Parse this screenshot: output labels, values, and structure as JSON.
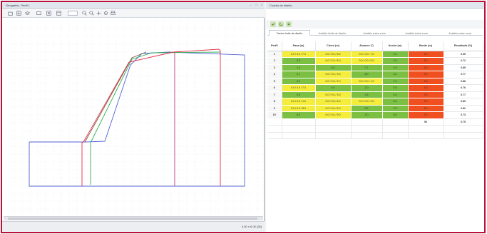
{
  "left_panel": {
    "title": "Geografía - Perfil 1",
    "status_coords": "0.00 x 0.00 (25)"
  },
  "right_panel": {
    "title": "Cuadro de diseño",
    "tabs": [
      "Factor límite de diseño",
      "Análisis límite de diseño",
      "Análisis sobre zona",
      "Análisis sobre zona",
      "Análisis sobre zona"
    ],
    "columns": [
      "Perfil",
      "Pasa (m)",
      "Cierre (m)",
      "Alcance (°)",
      "Ancho (m)",
      "Borde (m)",
      "Resultado (%)"
    ],
    "rows": [
      {
        "n": "1",
        "cells": [
          "0.0 / 0.0 / 7.0",
          "0.0 / 0.0 / 6.0",
          "0.0 / 0.0 / 7.0",
          "9.5",
          "3.0",
          "0.95"
        ],
        "colors": [
          "y",
          "y",
          "y",
          "g",
          "r",
          "w"
        ]
      },
      {
        "n": "2",
        "cells": [
          "5.0",
          "0.0 / 0.0 / 6.0",
          "0.0 / 0.0 / 5.0",
          "3.5",
          "3.0",
          "0.72"
        ],
        "colors": [
          "g",
          "y",
          "y",
          "g",
          "r",
          "w"
        ]
      },
      {
        "n": "3",
        "cells": [
          "1.4",
          "5.0",
          "0.7",
          "4.5",
          "3.0",
          "0.89"
        ],
        "colors": [
          "g",
          "g",
          "g",
          "g",
          "r",
          "w"
        ]
      },
      {
        "n": "4",
        "cells": [
          "3.7",
          "0.0 / 0.0 / 3.0",
          "6.0",
          "3.5",
          "3.0",
          "0.77"
        ],
        "colors": [
          "g",
          "y",
          "g",
          "g",
          "r",
          "w"
        ]
      },
      {
        "n": "5",
        "cells": [
          "8.0",
          "0.0 / 0.0 / 2.0",
          "0.0 / 0.0 / 1.0",
          "7.0",
          "3.0",
          "0.88"
        ],
        "colors": [
          "g",
          "y",
          "y",
          "g",
          "r",
          "w"
        ]
      },
      {
        "n": "6",
        "cells": [
          "0.0 / 0.0 / 7.0",
          "5.0",
          "2.0",
          "0.5",
          "3.0",
          "0.76"
        ],
        "colors": [
          "y",
          "g",
          "g",
          "g",
          "r",
          "w"
        ]
      },
      {
        "n": "7",
        "cells": [
          "9.0",
          "0.0 / 0.0 / 3.0",
          "3.5",
          "4.5",
          "3.0",
          "0.77"
        ],
        "colors": [
          "g",
          "y",
          "g",
          "g",
          "r",
          "w"
        ]
      },
      {
        "n": "8",
        "cells": [
          "0.0 / 0.0 / 1.0",
          "0.0 / 0.0 / 4.0",
          "0.0 / 0.0 / 3.0",
          "6.5",
          "3.0",
          "0.89"
        ],
        "colors": [
          "y",
          "y",
          "y",
          "g",
          "r",
          "w"
        ]
      },
      {
        "n": "9",
        "cells": [
          "0.0 / 0.0 / 8.0",
          "0.0 / 0.0 / 5.0",
          "5.5",
          "3.5",
          "3.0",
          "0.82"
        ],
        "colors": [
          "y",
          "y",
          "g",
          "g",
          "r",
          "w"
        ]
      },
      {
        "n": "10",
        "cells": [
          "8.0",
          "0.0 / 0.0 / 9.0",
          "3.0",
          "6.5",
          "3.0",
          "0.73"
        ],
        "colors": [
          "g",
          "y",
          "g",
          "g",
          "r",
          "w"
        ]
      }
    ],
    "total_row": {
      "borde": "50",
      "resultado": "0.75"
    }
  },
  "profile": {
    "lines": [
      {
        "color": "#5561d8",
        "points": [
          [
            36,
            196
          ],
          [
            115,
            196
          ],
          [
            142,
            195
          ],
          [
            178,
            88
          ],
          [
            194,
            72
          ],
          [
            232,
            70
          ],
          [
            338,
            74
          ],
          [
            338,
            258
          ],
          [
            36,
            258
          ],
          [
            36,
            196
          ]
        ]
      },
      {
        "color": "#7b5a3a",
        "points": [
          [
            114,
            196
          ],
          [
            180,
            78
          ],
          [
            200,
            70
          ]
        ]
      },
      {
        "color": "#2fae55",
        "points": [
          [
            122,
            197
          ],
          [
            122,
            256
          ],
          [
            122,
            197
          ],
          [
            180,
            80
          ],
          [
            208,
            71
          ],
          [
            304,
            70
          ]
        ]
      },
      {
        "color": "#e32f4a",
        "points": [
          [
            110,
            258
          ],
          [
            110,
            197
          ],
          [
            112,
            196
          ],
          [
            176,
            84
          ],
          [
            238,
            70
          ],
          [
            302,
            66
          ],
          [
            304,
            68
          ],
          [
            304,
            258
          ]
        ]
      },
      {
        "color": "#c9328a",
        "points": [
          [
            240,
            71
          ],
          [
            240,
            258
          ]
        ]
      }
    ]
  }
}
